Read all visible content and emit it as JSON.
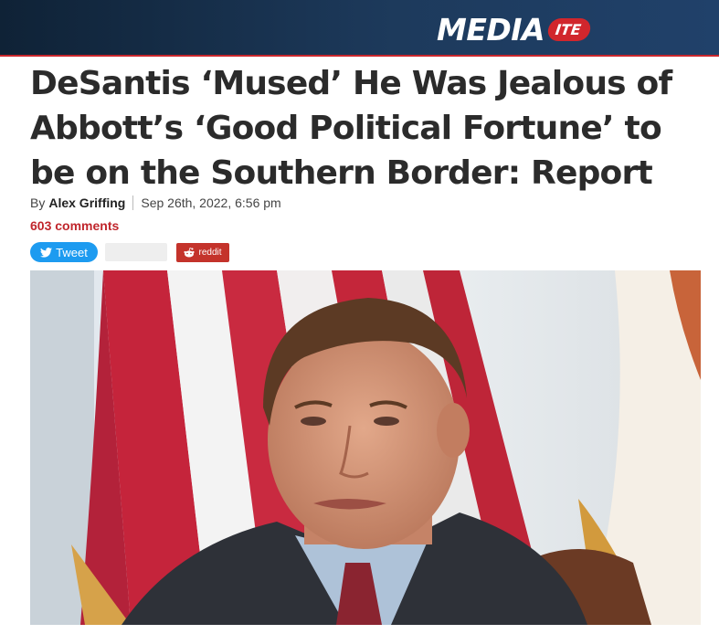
{
  "site": {
    "logo_main": "MEDIA",
    "logo_badge": "ITE"
  },
  "article": {
    "headline": "DeSantis ‘Mused’ He Was Jealous of Abbott’s ‘Good Political Fortune’ to be on the Southern Border: Report",
    "byline_prefix": "By",
    "author": "Alex Griffing",
    "date": "Sep 26th, 2022, 6:56 pm",
    "comments": "603 comments"
  },
  "share": {
    "tweet_label": "Tweet",
    "reddit_label": "reddit"
  },
  "colors": {
    "accent": "#c0262c",
    "twitter": "#1d9bf0",
    "reddit": "#c4332b",
    "header_bg": "#1a3352"
  },
  "icons": {
    "tweet": "twitter-bird-icon",
    "reddit": "reddit-alien-icon"
  }
}
